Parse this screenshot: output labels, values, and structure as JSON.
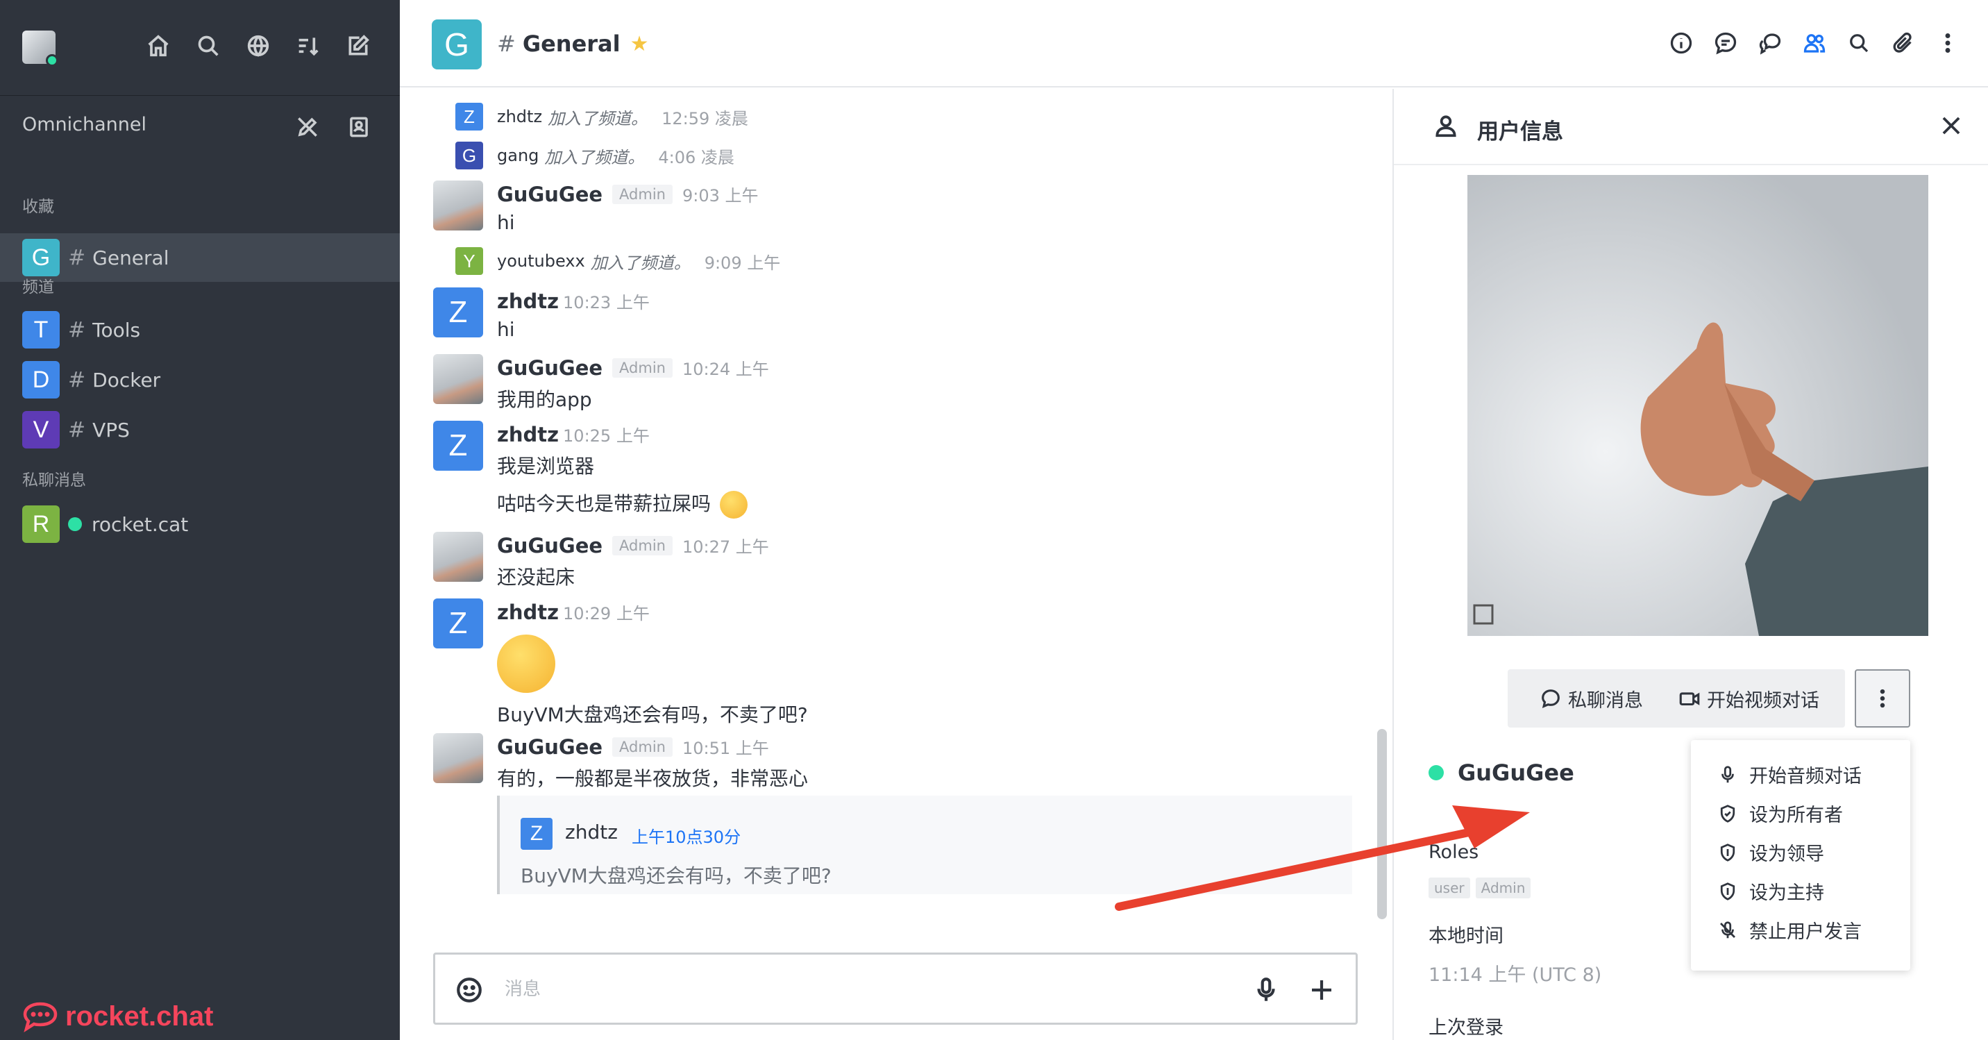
{
  "sidebar": {
    "workspace": "Omnichannel",
    "sections": {
      "favorites": "收藏",
      "channels": "频道",
      "direct": "私聊消息"
    },
    "favorites": [
      {
        "initial": "G",
        "name": "General",
        "color": "#3fb5c9"
      }
    ],
    "channels": [
      {
        "initial": "T",
        "name": "Tools",
        "color": "#3f87e8"
      },
      {
        "initial": "D",
        "name": "Docker",
        "color": "#3f87e8"
      },
      {
        "initial": "V",
        "name": "VPS",
        "color": "#5e3bb5"
      }
    ],
    "direct": [
      {
        "initial": "R",
        "name": "rocket.cat",
        "color": "#7cb342"
      }
    ],
    "logo_text": "rocket.chat"
  },
  "header": {
    "initial": "G",
    "room_name": "General",
    "accent": "#3fb5c9"
  },
  "messages": {
    "sys1": {
      "initial": "Z",
      "user": "zhdtz",
      "action": "加入了频道。",
      "time": "12:59 凌晨"
    },
    "sys2": {
      "initial": "G",
      "user": "gang",
      "action": "加入了频道。",
      "time": "4:06 凌晨"
    },
    "m1": {
      "user": "GuGuGee",
      "role": "Admin",
      "time": "9:03 上午",
      "text": "hi"
    },
    "sys3": {
      "initial": "Y",
      "user": "youtubexx",
      "action": "加入了频道。",
      "time": "9:09 上午"
    },
    "m2": {
      "initial": "Z",
      "user": "zhdtz",
      "time": "10:23 上午",
      "text": "hi"
    },
    "m3": {
      "user": "GuGuGee",
      "role": "Admin",
      "time": "10:24 上午",
      "text": "我用的app"
    },
    "m4": {
      "initial": "Z",
      "user": "zhdtz",
      "time": "10:25 上午",
      "text": "我是浏览器",
      "text2": "咕咕今天也是带薪拉屎吗"
    },
    "m5": {
      "user": "GuGuGee",
      "role": "Admin",
      "time": "10:27 上午",
      "text": "还没起床"
    },
    "m6": {
      "initial": "Z",
      "user": "zhdtz",
      "time": "10:29 上午",
      "text": "BuyVM大盘鸡还会有吗，不卖了吧?"
    },
    "m7": {
      "user": "GuGuGee",
      "role": "Admin",
      "time": "10:51 上午",
      "text": "有的，一般都是半夜放货，非常恶心"
    },
    "quote": {
      "initial": "Z",
      "user": "zhdtz",
      "time": "上午10点30分",
      "text": "BuyVM大盘鸡还会有吗，不卖了吧?"
    }
  },
  "composer": {
    "placeholder": "消息"
  },
  "panel": {
    "title": "用户信息",
    "btn_dm": "私聊消息",
    "btn_video": "开始视频对话",
    "username": "GuGuGee",
    "roles_label": "Roles",
    "roles": [
      "user",
      "Admin"
    ],
    "local_time_label": "本地时间",
    "local_time": "11:14 上午 (UTC 8)",
    "last_login_label": "上次登录"
  },
  "menu": {
    "items": [
      "开始音频对话",
      "设为所有者",
      "设为领导",
      "设为主持",
      "禁止用户发言"
    ]
  },
  "colors": {
    "sidebar_bg": "#2f343d",
    "brand": "#f5455c",
    "link": "#1d74f5",
    "online": "#2de0a5",
    "arrow": "#e8402e"
  }
}
